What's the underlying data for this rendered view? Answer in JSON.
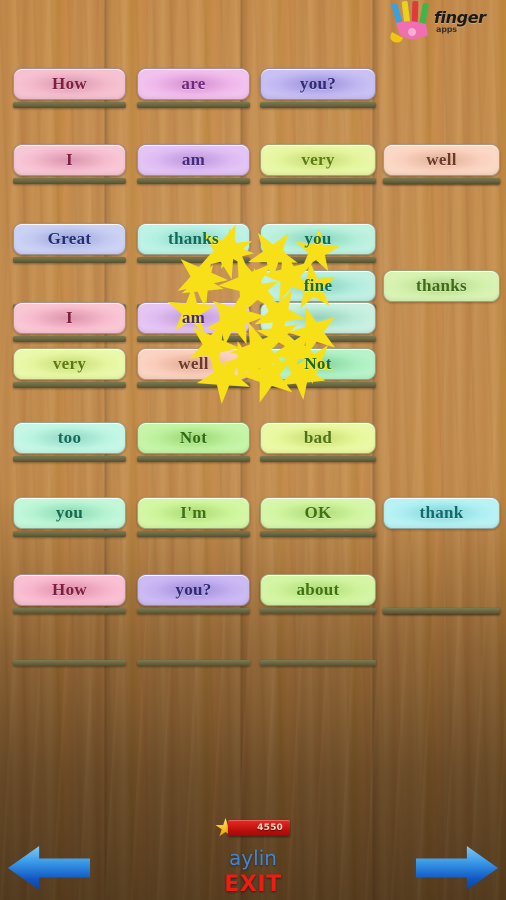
{
  "app": {
    "logo_word": "finger",
    "logo_sub": "apps",
    "background": "wood"
  },
  "colors": {
    "wood_light": "#c08a4e",
    "wood_dark": "#6b3f1c",
    "shelf": "#6d6944",
    "star": "#f7e017",
    "score_badge": "#c4120e",
    "username": "#3f86d6",
    "exit": "#f01b12",
    "arrow": "#1157c2"
  },
  "board": {
    "rows": [
      {
        "row_index": 0,
        "shelf_slots": 3,
        "tiles": [
          {
            "label": "How",
            "col": 0,
            "bg": "#f6c2d2",
            "glow": "#eda5bd",
            "fg": "#7d2040"
          },
          {
            "label": "are",
            "col": 1,
            "bg": "#f2c2ee",
            "glow": "#e89ce2",
            "fg": "#6b2a7a"
          },
          {
            "label": "you?",
            "col": 2,
            "bg": "#c9c0f4",
            "glow": "#a89ceb",
            "fg": "#2e2a78"
          }
        ]
      },
      {
        "row_index": 1,
        "shelf_slots": 4,
        "tiles": [
          {
            "label": "I",
            "col": 0,
            "bg": "#f8c7d6",
            "glow": "#f0a3bd",
            "fg": "#7d2040"
          },
          {
            "label": "am",
            "col": 1,
            "bg": "#e3c4f5",
            "glow": "#cfa3ee",
            "fg": "#432a80"
          },
          {
            "label": "very",
            "col": 2,
            "bg": "#e9f7a8",
            "glow": "#d8ef7e",
            "fg": "#5b7a12"
          },
          {
            "label": "well",
            "col": 3,
            "bg": "#fbd8c6",
            "glow": "#f6bfa5",
            "fg": "#6b3a28"
          }
        ]
      },
      {
        "row_index": 2,
        "shelf_slots": 3,
        "tiles": [
          {
            "label": "Great",
            "col": 0,
            "bg": "#ccd2f4",
            "glow": "#aab4ea",
            "fg": "#1f2f7a"
          },
          {
            "label": "thanks",
            "col": 1,
            "bg": "#bdf3e6",
            "glow": "#97e8d5",
            "fg": "#0f6b5b"
          },
          {
            "label": "you",
            "col": 2,
            "bg": "#bff2e0",
            "glow": "#96e7cd",
            "fg": "#116b4e"
          }
        ]
      },
      {
        "row_index": 3,
        "shelf_slots": 3,
        "tiles": [
          {
            "label": "fine",
            "col": 2,
            "bg": "#bff0e2",
            "glow": "#96e4d0",
            "fg": "#0f6b4e"
          },
          {
            "label": "thanks",
            "col": 3,
            "bg": "#d8f3b4",
            "glow": "#c2e894",
            "fg": "#3f6b18"
          }
        ]
      },
      {
        "row_index": 4,
        "shelf_slots": 3,
        "tiles": [
          {
            "label": "I",
            "col": 0,
            "bg": "#f9c6d4",
            "glow": "#f2a2bc",
            "fg": "#7d2040"
          },
          {
            "label": "am",
            "col": 1,
            "bg": "#e5c5f3",
            "glow": "#d1a4ea",
            "fg": "#432a80"
          },
          {
            "label": "",
            "col": 2,
            "bg": "#c9f0e0",
            "glow": "#a3e4cd",
            "fg": "#116b4e"
          }
        ]
      },
      {
        "row_index": 5,
        "shelf_slots": 3,
        "tiles": [
          {
            "label": "very",
            "col": 0,
            "bg": "#eaf8ab",
            "glow": "#d9f081",
            "fg": "#5b7a12"
          },
          {
            "label": "well",
            "col": 1,
            "bg": "#fbd3c2",
            "glow": "#f5b8a0",
            "fg": "#6b3a28"
          },
          {
            "label": "Not",
            "col": 2,
            "bg": "#b7f2c9",
            "glow": "#8fe6aa",
            "fg": "#17692e"
          }
        ]
      },
      {
        "row_index": 6,
        "shelf_slots": 3,
        "tiles": [
          {
            "label": "too",
            "col": 0,
            "bg": "#c6f7e6",
            "glow": "#9eecd4",
            "fg": "#116b5b"
          },
          {
            "label": "Not",
            "col": 1,
            "bg": "#c6f4a8",
            "glow": "#a9e97f",
            "fg": "#2f6d14"
          },
          {
            "label": "bad",
            "col": 2,
            "bg": "#ebf9a6",
            "glow": "#d9f07c",
            "fg": "#4d7312"
          }
        ]
      },
      {
        "row_index": 7,
        "shelf_slots": 3,
        "tiles": [
          {
            "label": "you",
            "col": 0,
            "bg": "#c2f7da",
            "glow": "#99ecc2",
            "fg": "#116b4e"
          },
          {
            "label": "I'm",
            "col": 1,
            "bg": "#d4f7a6",
            "glow": "#bcee7d",
            "fg": "#3f7312"
          },
          {
            "label": "OK",
            "col": 2,
            "bg": "#d6f7ab",
            "glow": "#bfee82",
            "fg": "#3f7312"
          },
          {
            "label": "thank",
            "col": 3,
            "bg": "#b9f2f4",
            "glow": "#8fe6ea",
            "fg": "#116b6b"
          }
        ]
      },
      {
        "row_index": 8,
        "shelf_slots": 4,
        "tiles": [
          {
            "label": "How",
            "col": 0,
            "bg": "#f9bfd2",
            "glow": "#f19ab9",
            "fg": "#7d2040"
          },
          {
            "label": "you?",
            "col": 1,
            "bg": "#cbbaf3",
            "glow": "#ae99ea",
            "fg": "#2e2a78"
          },
          {
            "label": "about",
            "col": 2,
            "bg": "#d4f5a6",
            "glow": "#bdec7d",
            "fg": "#3f7312"
          }
        ]
      },
      {
        "row_index": 9,
        "shelf_slots": 3,
        "tiles": []
      }
    ]
  },
  "effects": {
    "star_burst_label": "star-burst-reward"
  },
  "bottom_bar": {
    "score": "4550",
    "username": "aylin",
    "exit_label": "EXIT",
    "prev_label": "previous",
    "next_label": "next"
  }
}
